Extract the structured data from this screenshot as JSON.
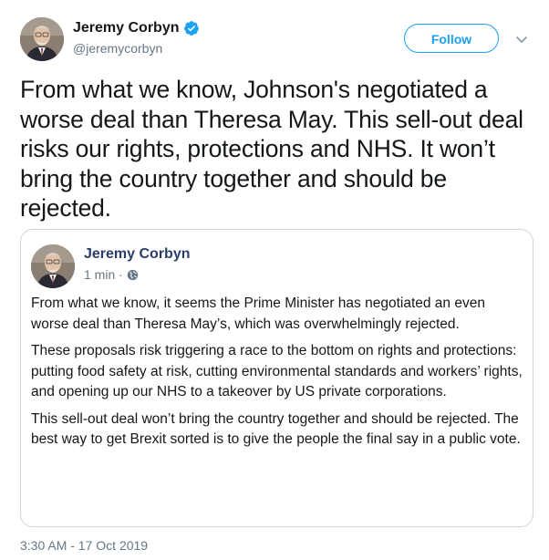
{
  "author": {
    "display_name": "Jeremy Corbyn",
    "handle": "@jeremycorbyn",
    "verified": true,
    "verified_icon": "verified-badge-icon"
  },
  "actions": {
    "follow_label": "Follow",
    "menu_icon": "chevron-down-icon"
  },
  "tweet": {
    "text": "From what we know, Johnson's negotiated a worse deal than Theresa May. This sell-out deal risks our rights, protections and NHS. It won’t bring the country together and should be rejected.",
    "timestamp": "3:30 AM - 17 Oct 2019"
  },
  "quoted": {
    "display_name": "Jeremy Corbyn",
    "time": "1 min ·",
    "visibility_icon": "globe-icon",
    "paragraphs": [
      "From what we know, it seems the Prime Minister has negotiated an even worse deal than Theresa May’s, which was overwhelmingly rejected.",
      "These proposals risk triggering a race to the bottom on rights and protections: putting food safety at risk, cutting environmental standards and workers’ rights, and opening up our NHS to a takeover by US private corporations.",
      "This sell-out deal won’t bring the country together and should be rejected. The best way to get Brexit sorted is to give the people the final say in a public vote."
    ]
  },
  "colors": {
    "accent": "#1da1f2",
    "text": "#14171a",
    "secondary": "#657786",
    "border": "#ccd6dd"
  }
}
